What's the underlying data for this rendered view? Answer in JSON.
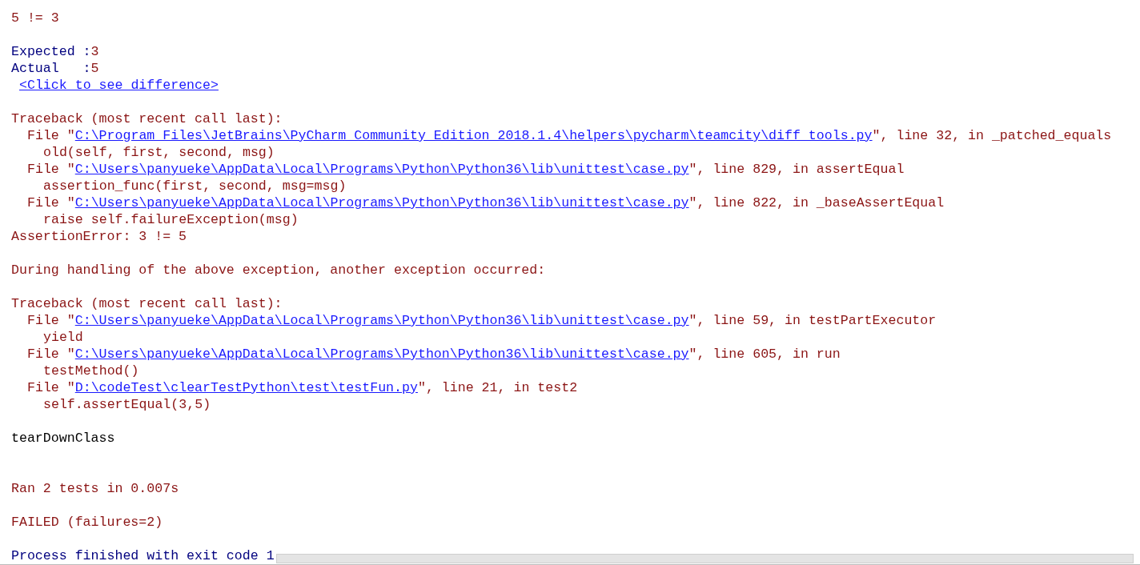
{
  "console": {
    "lines": [
      {
        "kind": "plain",
        "segments": [
          {
            "kind": "error",
            "text": "5 != 3"
          }
        ]
      },
      {
        "kind": "blank"
      },
      {
        "kind": "plain",
        "segments": [
          {
            "kind": "output",
            "text": "Expected :"
          },
          {
            "kind": "error",
            "text": "3"
          }
        ]
      },
      {
        "kind": "plain",
        "segments": [
          {
            "kind": "output",
            "text": "Actual   :"
          },
          {
            "kind": "error",
            "text": "5"
          }
        ]
      },
      {
        "kind": "link-line",
        "segments": [
          {
            "kind": "link",
            "text": "<Click to see difference>"
          }
        ]
      },
      {
        "kind": "blank"
      },
      {
        "kind": "plain",
        "segments": [
          {
            "kind": "error",
            "text": "Traceback (most recent call last):"
          }
        ]
      },
      {
        "kind": "frame",
        "segments": [
          {
            "kind": "error",
            "text": "File \""
          },
          {
            "kind": "link",
            "text": "C:\\Program Files\\JetBrains\\PyCharm Community Edition 2018.1.4\\helpers\\pycharm\\teamcity\\diff_tools.py"
          },
          {
            "kind": "error",
            "text": "\", line 32, in _patched_equals"
          }
        ]
      },
      {
        "kind": "code",
        "segments": [
          {
            "kind": "error",
            "text": "old(self, first, second, msg)"
          }
        ]
      },
      {
        "kind": "frame",
        "segments": [
          {
            "kind": "error",
            "text": "File \""
          },
          {
            "kind": "link",
            "text": "C:\\Users\\panyueke\\AppData\\Local\\Programs\\Python\\Python36\\lib\\unittest\\case.py"
          },
          {
            "kind": "error",
            "text": "\", line 829, in assertEqual"
          }
        ]
      },
      {
        "kind": "code",
        "segments": [
          {
            "kind": "error",
            "text": "assertion_func(first, second, msg=msg)"
          }
        ]
      },
      {
        "kind": "frame",
        "segments": [
          {
            "kind": "error",
            "text": "File \""
          },
          {
            "kind": "link",
            "text": "C:\\Users\\panyueke\\AppData\\Local\\Programs\\Python\\Python36\\lib\\unittest\\case.py"
          },
          {
            "kind": "error",
            "text": "\", line 822, in _baseAssertEqual"
          }
        ]
      },
      {
        "kind": "code",
        "segments": [
          {
            "kind": "error",
            "text": "raise self.failureException(msg)"
          }
        ]
      },
      {
        "kind": "plain",
        "segments": [
          {
            "kind": "error",
            "text": "AssertionError: 3 != 5"
          }
        ]
      },
      {
        "kind": "blank"
      },
      {
        "kind": "plain",
        "segments": [
          {
            "kind": "error",
            "text": "During handling of the above exception, another exception occurred:"
          }
        ]
      },
      {
        "kind": "blank"
      },
      {
        "kind": "plain",
        "segments": [
          {
            "kind": "error",
            "text": "Traceback (most recent call last):"
          }
        ]
      },
      {
        "kind": "frame",
        "segments": [
          {
            "kind": "error",
            "text": "File \""
          },
          {
            "kind": "link",
            "text": "C:\\Users\\panyueke\\AppData\\Local\\Programs\\Python\\Python36\\lib\\unittest\\case.py"
          },
          {
            "kind": "error",
            "text": "\", line 59, in testPartExecutor"
          }
        ]
      },
      {
        "kind": "code",
        "segments": [
          {
            "kind": "error",
            "text": "yield"
          }
        ]
      },
      {
        "kind": "frame",
        "segments": [
          {
            "kind": "error",
            "text": "File \""
          },
          {
            "kind": "link",
            "text": "C:\\Users\\panyueke\\AppData\\Local\\Programs\\Python\\Python36\\lib\\unittest\\case.py"
          },
          {
            "kind": "error",
            "text": "\", line 605, in run"
          }
        ]
      },
      {
        "kind": "code",
        "segments": [
          {
            "kind": "error",
            "text": "testMethod()"
          }
        ]
      },
      {
        "kind": "frame",
        "segments": [
          {
            "kind": "error",
            "text": "File \""
          },
          {
            "kind": "link",
            "text": "D:\\codeTest\\clearTestPython\\test\\testFun.py"
          },
          {
            "kind": "error",
            "text": "\", line 21, in test2"
          }
        ]
      },
      {
        "kind": "code",
        "segments": [
          {
            "kind": "error",
            "text": "self.assertEqual(3,5)"
          }
        ]
      },
      {
        "kind": "blank"
      },
      {
        "kind": "plain",
        "segments": [
          {
            "kind": "plain",
            "text": "tearDownClass"
          }
        ]
      },
      {
        "kind": "blank"
      },
      {
        "kind": "blank"
      },
      {
        "kind": "plain",
        "segments": [
          {
            "kind": "error",
            "text": "Ran 2 tests in 0.007s"
          }
        ]
      },
      {
        "kind": "blank"
      },
      {
        "kind": "plain",
        "segments": [
          {
            "kind": "error",
            "text": "FAILED (failures=2)"
          }
        ]
      },
      {
        "kind": "blank"
      },
      {
        "kind": "plain",
        "segments": [
          {
            "kind": "output",
            "text": "Process finished with exit code 1"
          }
        ]
      }
    ]
  }
}
